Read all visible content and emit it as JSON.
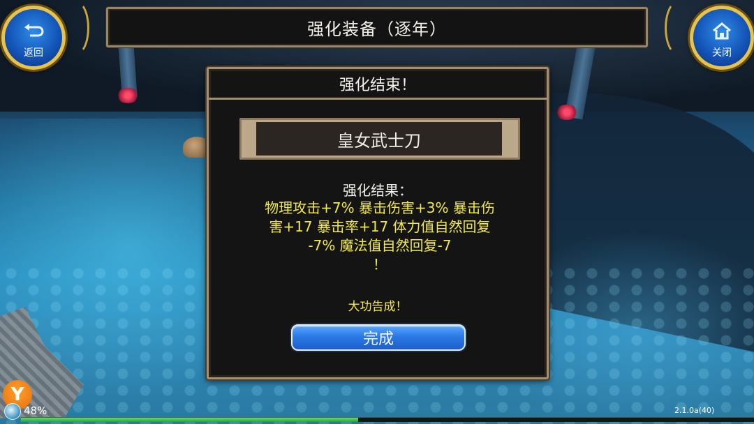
{
  "header": {
    "title": "强化装备（逐年）",
    "back_label": "返回",
    "close_label": "关闭",
    "back_icon": "return-arrow-icon",
    "close_icon": "home-icon"
  },
  "dialog": {
    "title": "强化结束！",
    "item_name": "皇女武士刀",
    "result_label": "强化结果：",
    "result_lines": [
      "物理攻击+7% 暴击伤害+3% 暴击伤",
      "害+17 暴击率+17 体力值自然回复",
      "-7% 魔法值自然回复-7",
      "！"
    ],
    "success_text": "大功告成！",
    "done_button": "完成"
  },
  "hud": {
    "battery": "48%",
    "version": "2.1.0a(40)",
    "progress": 0.46
  },
  "colors": {
    "panel_border": "#a48f70",
    "result_text": "#f2ea4a",
    "button_blue": "#2b79e6",
    "round_button_gold": "#e6c34f"
  }
}
